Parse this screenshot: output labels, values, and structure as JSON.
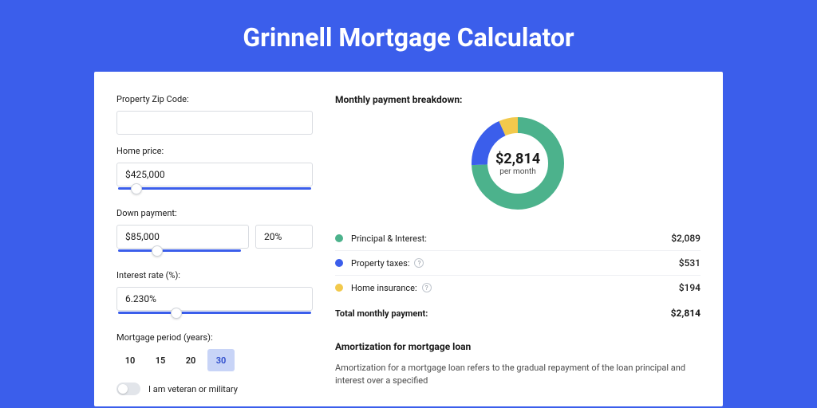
{
  "title": "Grinnell Mortgage Calculator",
  "form": {
    "zip_label": "Property Zip Code:",
    "zip_value": "",
    "home_price_label": "Home price:",
    "home_price_value": "$425,000",
    "down_payment_label": "Down payment:",
    "down_payment_value": "$85,000",
    "down_payment_pct": "20%",
    "interest_label": "Interest rate (%):",
    "interest_value": "6.230%",
    "period_label": "Mortgage period (years):",
    "periods": [
      "10",
      "15",
      "20",
      "30"
    ],
    "period_selected": "30",
    "veteran_label": "I am veteran or military"
  },
  "breakdown": {
    "title": "Monthly payment breakdown:",
    "center_amount": "$2,814",
    "center_sub": "per month",
    "items": [
      {
        "label": "Principal & Interest:",
        "value": "$2,089"
      },
      {
        "label": "Property taxes:",
        "value": "$531",
        "info": true
      },
      {
        "label": "Home insurance:",
        "value": "$194",
        "info": true
      }
    ],
    "total_label": "Total monthly payment:",
    "total_value": "$2,814"
  },
  "chart_data": {
    "type": "pie",
    "title": "Monthly payment breakdown",
    "categories": [
      "Principal & Interest",
      "Property taxes",
      "Home insurance"
    ],
    "values": [
      2089,
      531,
      194
    ],
    "colors": [
      "#4cb28c",
      "#3b5eeb",
      "#f2c94c"
    ],
    "center_label": "$2,814 per month"
  },
  "amort": {
    "title": "Amortization for mortgage loan",
    "text": "Amortization for a mortgage loan refers to the gradual repayment of the loan principal and interest over a specified"
  }
}
